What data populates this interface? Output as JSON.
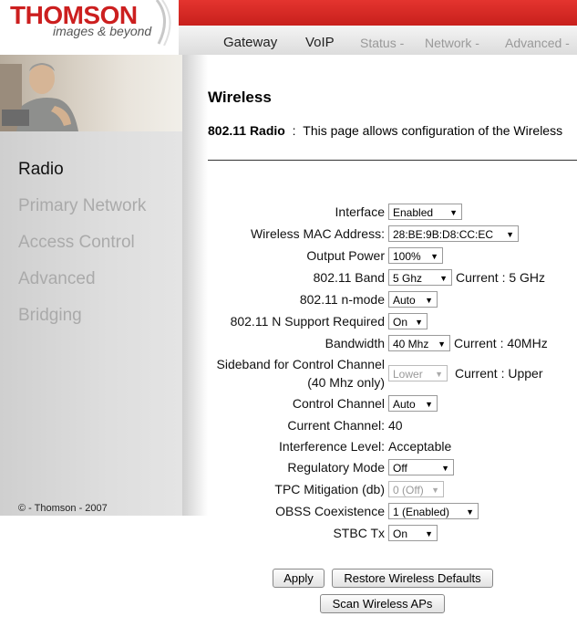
{
  "brand": {
    "name": "THOMSON",
    "tagline": "images & beyond"
  },
  "nav": {
    "items": [
      "Gateway",
      "VoIP",
      "Status -",
      "Network -",
      "Advanced -"
    ]
  },
  "sidebar": {
    "items": [
      "Radio",
      "Primary Network",
      "Access Control",
      "Advanced",
      "Bridging"
    ],
    "active": "Radio"
  },
  "copyright": "© - Thomson - 2007",
  "page": {
    "title": "Wireless",
    "desc_label": "802.11 Radio",
    "desc_sep": ":",
    "desc_text": "This page allows configuration of the Wireless"
  },
  "form": {
    "interface": {
      "label": "Interface",
      "value": "Enabled"
    },
    "mac": {
      "label": "Wireless MAC Address:",
      "value": "28:BE:9B:D8:CC:EC"
    },
    "power": {
      "label": "Output Power",
      "value": "100%"
    },
    "band": {
      "label": "802.11 Band",
      "value": "5 Ghz",
      "current": "Current :  5 GHz"
    },
    "nmode": {
      "label": "802.11 n-mode",
      "value": "Auto"
    },
    "nreq": {
      "label": "802.11 N Support Required",
      "value": "On"
    },
    "bandwidth": {
      "label": "Bandwidth",
      "value": "40 Mhz",
      "current": "Current :  40MHz"
    },
    "sideband": {
      "label1": "Sideband for Control Channel",
      "label2": "(40 Mhz only)",
      "value": "Lower",
      "current": "Current : Upper"
    },
    "control_channel": {
      "label": "Control Channel",
      "value": "Auto"
    },
    "current_channel": {
      "label": "Current Channel:",
      "value": "40"
    },
    "interference": {
      "label": "Interference Level:",
      "value": "Acceptable"
    },
    "regulatory": {
      "label": "Regulatory Mode",
      "value": "Off"
    },
    "tpc": {
      "label": "TPC Mitigation (db)",
      "value": "0 (Off)"
    },
    "obss": {
      "label": "OBSS Coexistence",
      "value": "1 (Enabled)"
    },
    "stbc": {
      "label": "STBC Tx",
      "value": "On"
    }
  },
  "buttons": {
    "apply": "Apply",
    "restore": "Restore Wireless Defaults",
    "scan": "Scan Wireless APs"
  },
  "colors": {
    "brand_red": "#cc1f1f",
    "sidebar_bg": "#d6d6d6",
    "sidebar_inactive": "#aaaaaa"
  }
}
